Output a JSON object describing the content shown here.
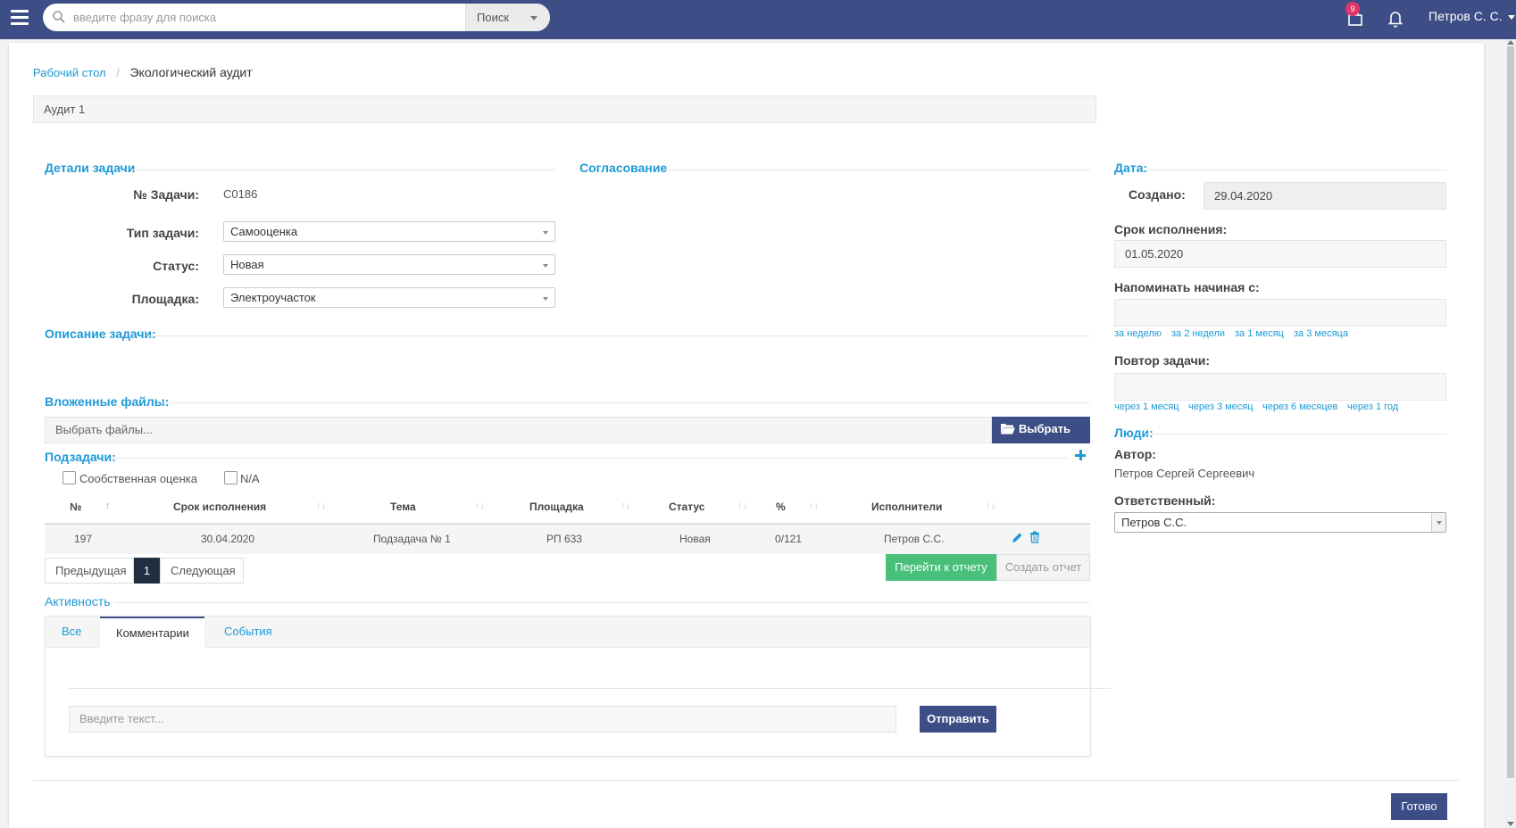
{
  "header": {
    "search_placeholder": "введите фразу для поиска",
    "search_button": "Поиск",
    "notifications_count": "9",
    "user_name": "Петров С. С."
  },
  "breadcrumb": {
    "home": "Рабочий стол",
    "separator": "/",
    "current": "Экологический аудит"
  },
  "audit_title": "Аудит 1",
  "task_details": {
    "section_title": "Детали задачи",
    "task_no_label": "№ Задачи:",
    "task_no_value": "C0186",
    "task_type_label": "Тип задачи:",
    "task_type_value": "Самооценка",
    "status_label": "Статус:",
    "status_value": "Новая",
    "site_label": "Площадка:",
    "site_value": "Электроучасток"
  },
  "approval": {
    "section_title": "Согласование"
  },
  "description": {
    "section_title": "Описание задачи:"
  },
  "attachments": {
    "section_title": "Вложенные файлы:",
    "input_placeholder": "Выбрать файлы...",
    "choose_button": "Выбрать ..."
  },
  "subtasks": {
    "section_title": "Подзадачи:",
    "checkbox_self": "Сообственная оценка",
    "checkbox_na": "N/A",
    "columns": [
      "№",
      "Срок исполнения",
      "Тема",
      "Площадка",
      "Статус",
      "%",
      "Исполнители"
    ],
    "rows": [
      {
        "no": "197",
        "deadline": "30.04.2020",
        "subject": "Подзадача № 1",
        "site": "РП 633",
        "status": "Новая",
        "percent": "0/121",
        "assignees": "Петров С.С."
      }
    ],
    "pager": {
      "prev": "Предыдущая",
      "current": "1",
      "next": "Следующая"
    },
    "go_report_button": "Перейти к отчету",
    "create_report_button": "Создать отчет"
  },
  "activity": {
    "section_title": "Активность",
    "tabs": [
      "Все",
      "Комментарии",
      "События"
    ],
    "active_tab": "Комментарии",
    "comment_placeholder": "Введите текст...",
    "send_button": "Отправить"
  },
  "dates": {
    "section_title": "Дата:",
    "created_label": "Создано:",
    "created_value": "29.04.2020",
    "deadline_label": "Срок исполнения:",
    "deadline_value": "01.05.2020",
    "remind_label": "Напоминать начиная с:",
    "remind_options": [
      "за неделю",
      "за 2 недели",
      "за 1 месяц",
      "за 3 месяца"
    ],
    "repeat_label": "Повтор задачи:",
    "repeat_options": [
      "через 1 месяц",
      "через 3 месяц",
      "через 6 месяцев",
      "через 1 год"
    ]
  },
  "people": {
    "section_title": "Люди:",
    "author_label": "Автор:",
    "author_value": "Петров Сергей Сергеевич",
    "responsible_label": "Ответственный:",
    "responsible_value": "Петров С.С."
  },
  "footer": {
    "done_button": "Готово"
  },
  "colors": {
    "header_bg": "#3d4e86",
    "accent": "#1e9ad6",
    "success": "#48c07a",
    "badge": "#e2336b"
  }
}
